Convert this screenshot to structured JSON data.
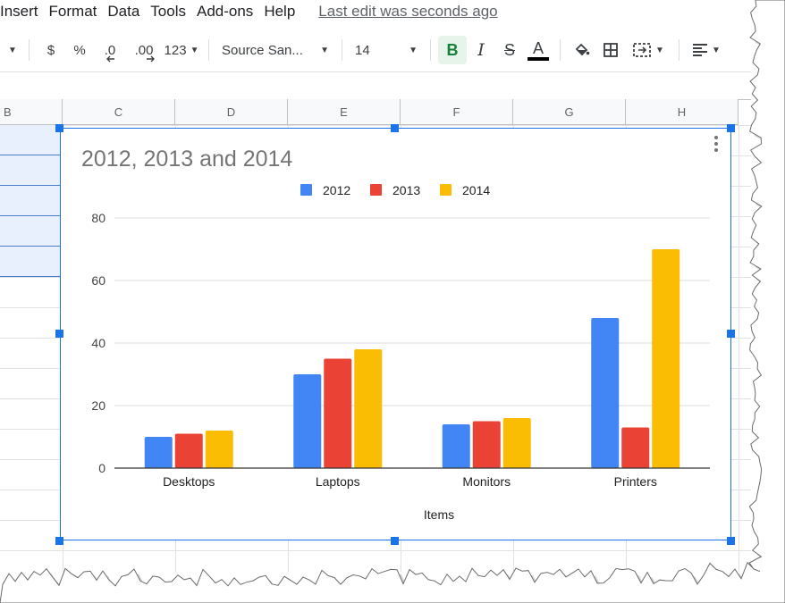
{
  "menu": {
    "items": [
      "Insert",
      "Format",
      "Data",
      "Tools",
      "Add-ons",
      "Help"
    ],
    "last_edit": "Last edit was seconds ago"
  },
  "toolbar": {
    "currency": "$",
    "percent": "%",
    "decrease_decimal": ".0",
    "increase_decimal": ".00",
    "more_formats": "123",
    "font": "Source San...",
    "font_size": "14",
    "bold": "B",
    "italic": "I",
    "strike": "S",
    "text_color": "A",
    "icons": [
      "fill-color-icon",
      "borders-icon",
      "merge-cells-icon",
      "align-left-icon"
    ]
  },
  "columns": [
    "B",
    "C",
    "D",
    "E",
    "F",
    "G",
    "H"
  ],
  "colors": {
    "selection": "#1a73e8",
    "bold_active_bg": "#e6f4ea",
    "bold_active_fg": "#188038"
  },
  "chart_data": {
    "type": "bar",
    "title": "2012, 2013 and 2014",
    "xlabel": "Items",
    "ylabel": "",
    "categories": [
      "Desktops",
      "Laptops",
      "Monitors",
      "Printers"
    ],
    "series": [
      {
        "name": "2012",
        "color": "#4285f4",
        "values": [
          10,
          30,
          14,
          48
        ]
      },
      {
        "name": "2013",
        "color": "#ea4335",
        "values": [
          11,
          35,
          15,
          13
        ]
      },
      {
        "name": "2014",
        "color": "#fbbc04",
        "values": [
          12,
          38,
          16,
          70
        ]
      }
    ],
    "ylim": [
      0,
      80
    ],
    "yticks": [
      "0",
      "20",
      "40",
      "60",
      "80"
    ],
    "grid": true,
    "legend": "top"
  }
}
